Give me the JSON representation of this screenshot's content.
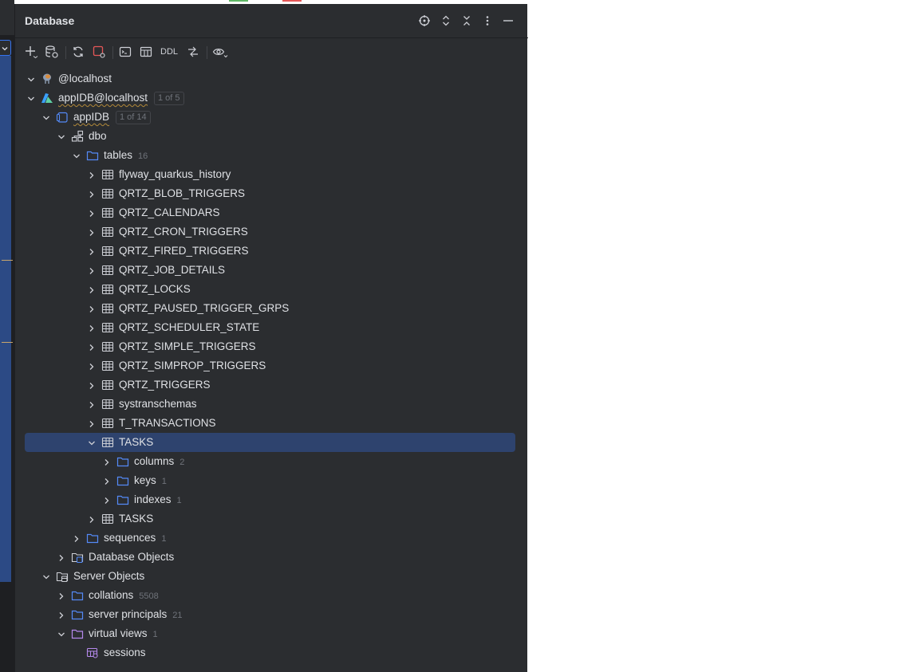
{
  "panel": {
    "title": "Database",
    "header_icons": [
      "crosshair-icon",
      "expand-all-icon",
      "collapse-all-icon",
      "more-options-icon",
      "minimize-icon"
    ]
  },
  "toolbar": {
    "ddl_label": "DDL",
    "icons": [
      "add-icon",
      "data-source-properties-icon",
      "refresh-icon",
      "stop-icon",
      "query-console-icon",
      "table-editor-icon",
      "ddl-button",
      "jump-to-icon",
      "view-options-icon"
    ]
  },
  "tree": [
    {
      "label": "@localhost",
      "count": "",
      "badge": "",
      "depth": 0,
      "expanded": true,
      "has_chevron": true,
      "icon": "pg-server-icon",
      "selected": false
    },
    {
      "label": "appIDB@localhost",
      "count": "",
      "badge": "1 of 5",
      "depth": 0,
      "expanded": true,
      "has_chevron": true,
      "icon": "azure-datasource-icon",
      "selected": false
    },
    {
      "label": "appIDB",
      "count": "",
      "badge": "1 of 14",
      "depth": 1,
      "expanded": true,
      "has_chevron": true,
      "icon": "database-icon",
      "selected": false
    },
    {
      "label": "dbo",
      "count": "",
      "badge": "",
      "depth": 2,
      "expanded": true,
      "has_chevron": true,
      "icon": "schema-icon",
      "selected": false
    },
    {
      "label": "tables",
      "count": "16",
      "badge": "",
      "depth": 3,
      "expanded": true,
      "has_chevron": true,
      "icon": "folder-icon",
      "selected": false
    },
    {
      "label": "flyway_quarkus_history",
      "count": "",
      "badge": "",
      "depth": 4,
      "expanded": false,
      "has_chevron": true,
      "icon": "table-icon",
      "selected": false
    },
    {
      "label": "QRTZ_BLOB_TRIGGERS",
      "count": "",
      "badge": "",
      "depth": 4,
      "expanded": false,
      "has_chevron": true,
      "icon": "table-icon",
      "selected": false
    },
    {
      "label": "QRTZ_CALENDARS",
      "count": "",
      "badge": "",
      "depth": 4,
      "expanded": false,
      "has_chevron": true,
      "icon": "table-icon",
      "selected": false
    },
    {
      "label": "QRTZ_CRON_TRIGGERS",
      "count": "",
      "badge": "",
      "depth": 4,
      "expanded": false,
      "has_chevron": true,
      "icon": "table-icon",
      "selected": false
    },
    {
      "label": "QRTZ_FIRED_TRIGGERS",
      "count": "",
      "badge": "",
      "depth": 4,
      "expanded": false,
      "has_chevron": true,
      "icon": "table-icon",
      "selected": false
    },
    {
      "label": "QRTZ_JOB_DETAILS",
      "count": "",
      "badge": "",
      "depth": 4,
      "expanded": false,
      "has_chevron": true,
      "icon": "table-icon",
      "selected": false
    },
    {
      "label": "QRTZ_LOCKS",
      "count": "",
      "badge": "",
      "depth": 4,
      "expanded": false,
      "has_chevron": true,
      "icon": "table-icon",
      "selected": false
    },
    {
      "label": "QRTZ_PAUSED_TRIGGER_GRPS",
      "count": "",
      "badge": "",
      "depth": 4,
      "expanded": false,
      "has_chevron": true,
      "icon": "table-icon",
      "selected": false
    },
    {
      "label": "QRTZ_SCHEDULER_STATE",
      "count": "",
      "badge": "",
      "depth": 4,
      "expanded": false,
      "has_chevron": true,
      "icon": "table-icon",
      "selected": false
    },
    {
      "label": "QRTZ_SIMPLE_TRIGGERS",
      "count": "",
      "badge": "",
      "depth": 4,
      "expanded": false,
      "has_chevron": true,
      "icon": "table-icon",
      "selected": false
    },
    {
      "label": "QRTZ_SIMPROP_TRIGGERS",
      "count": "",
      "badge": "",
      "depth": 4,
      "expanded": false,
      "has_chevron": true,
      "icon": "table-icon",
      "selected": false
    },
    {
      "label": "QRTZ_TRIGGERS",
      "count": "",
      "badge": "",
      "depth": 4,
      "expanded": false,
      "has_chevron": true,
      "icon": "table-icon",
      "selected": false
    },
    {
      "label": "systranschemas",
      "count": "",
      "badge": "",
      "depth": 4,
      "expanded": false,
      "has_chevron": true,
      "icon": "table-icon",
      "selected": false
    },
    {
      "label": "T_TRANSACTIONS",
      "count": "",
      "badge": "",
      "depth": 4,
      "expanded": false,
      "has_chevron": true,
      "icon": "table-icon",
      "selected": false
    },
    {
      "label": "TASKS",
      "count": "",
      "badge": "",
      "depth": 4,
      "expanded": true,
      "has_chevron": true,
      "icon": "table-icon",
      "selected": true
    },
    {
      "label": "columns",
      "count": "2",
      "badge": "",
      "depth": 5,
      "expanded": false,
      "has_chevron": true,
      "icon": "folder-icon",
      "selected": false
    },
    {
      "label": "keys",
      "count": "1",
      "badge": "",
      "depth": 5,
      "expanded": false,
      "has_chevron": true,
      "icon": "folder-icon",
      "selected": false
    },
    {
      "label": "indexes",
      "count": "1",
      "badge": "",
      "depth": 5,
      "expanded": false,
      "has_chevron": true,
      "icon": "folder-icon",
      "selected": false
    },
    {
      "label": "TASKS",
      "count": "",
      "badge": "",
      "depth": 4,
      "expanded": false,
      "has_chevron": true,
      "icon": "table-icon",
      "selected": false
    },
    {
      "label": "sequences",
      "count": "1",
      "badge": "",
      "depth": 3,
      "expanded": false,
      "has_chevron": true,
      "icon": "folder-icon",
      "selected": false
    },
    {
      "label": "Database Objects",
      "count": "",
      "badge": "",
      "depth": 2,
      "expanded": false,
      "has_chevron": true,
      "icon": "database-objects-icon",
      "selected": false
    },
    {
      "label": "Server Objects",
      "count": "",
      "badge": "",
      "depth": 1,
      "expanded": true,
      "has_chevron": true,
      "icon": "server-objects-icon",
      "selected": false
    },
    {
      "label": "collations",
      "count": "5508",
      "badge": "",
      "depth": 2,
      "expanded": false,
      "has_chevron": true,
      "icon": "folder-icon",
      "selected": false
    },
    {
      "label": "server principals",
      "count": "21",
      "badge": "",
      "depth": 2,
      "expanded": false,
      "has_chevron": true,
      "icon": "folder-icon",
      "selected": false
    },
    {
      "label": "virtual views",
      "count": "1",
      "badge": "",
      "depth": 2,
      "expanded": true,
      "has_chevron": true,
      "icon": "virtual-folder-icon",
      "selected": false
    },
    {
      "label": "sessions",
      "count": "",
      "badge": "",
      "depth": 3,
      "expanded": false,
      "has_chevron": false,
      "icon": "virtual-view-icon",
      "selected": false
    }
  ]
}
